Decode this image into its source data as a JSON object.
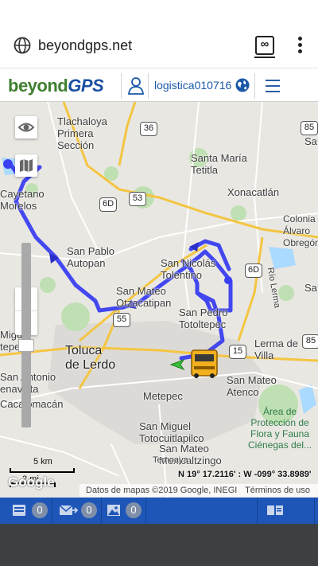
{
  "browser": {
    "url": "beyondgps.net",
    "tabs_count": "∞"
  },
  "app": {
    "logo_left": "beyond",
    "logo_right": "GPS",
    "username": "logistica010716"
  },
  "map": {
    "labels": {
      "tlachaloya": "Tlachaloya\nPrimera\nSección",
      "santa_maria": "Santa María\nTetitla",
      "xonacatlan": "Xonacatlán",
      "colonia_alvaro": "Colonia\nÁlvaro\nObregón",
      "cayetano": "Cayetano\nMorelos",
      "san_pablo": "San Pablo\nAutopan",
      "san_nicolas": "San Nicolás\nTolentino",
      "san_mateo_otz": "San Mateo\nOtzacatipan",
      "san_pedro": "San Pedro\nTotoltepec",
      "toluca": "Toluca\nde Lerdo",
      "miguel": "Miguel\ntepec",
      "lerma": "Lerma de\nVilla",
      "san_mateo_atenco": "San Mateo\nAtenco",
      "san_antonio": "San Antonio\nenavista",
      "metepec": "Metepec",
      "cacalomacan": "Cacalomacán",
      "san_miguel_toto": "San Miguel\nTotocuitlapilco",
      "san_mateo_mex": "San Mateo\nMexicaltzingo",
      "temoaya": "Temoaya",
      "rio_lerma": "Río Lerma",
      "sa": "Sa",
      "sa2": "Sa",
      "area_proteccion": "Área de\nProtección de\nFlora y Fauna\nCiénegas del..."
    },
    "shields": {
      "s36": "36",
      "s85": "85",
      "s53": "53",
      "s6d_left": "6D",
      "s6d_right": "6D",
      "s55": "55",
      "s15": "15",
      "s85b": "85"
    },
    "zoom_in": "+",
    "zoom_out": "−",
    "scale_km": "5 km",
    "scale_mi": "2 mi",
    "google": "Google",
    "attribution": "Datos de mapas ©2019 Google, INEGI",
    "terms": "Términos de uso",
    "coordinates": "N 19° 17.2116' : W -099° 33.8989'",
    "zoom_level_fraction": 0.45
  },
  "status": {
    "messages_count": "0",
    "alerts_count": "0",
    "images_count": "0"
  },
  "colors": {
    "route": "#3a3ff0",
    "status_bar": "#1e56b8",
    "accent": "#1a58a8"
  }
}
